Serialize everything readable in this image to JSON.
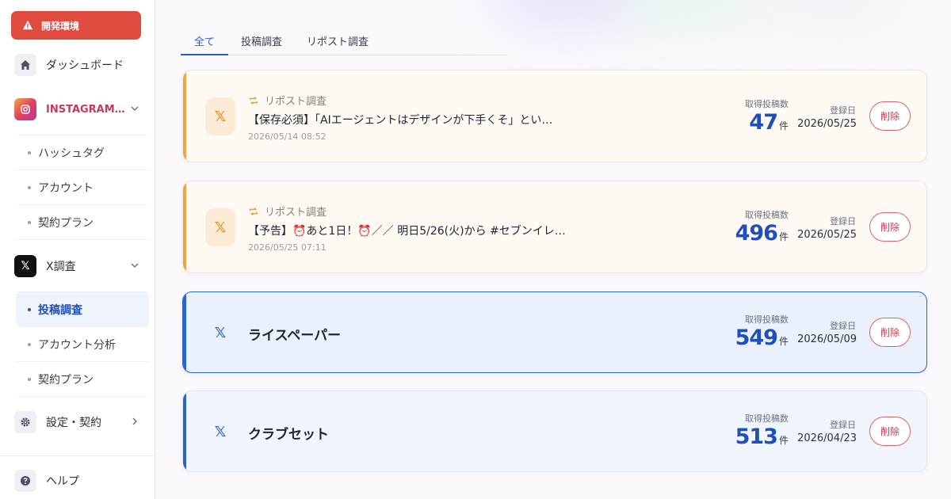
{
  "sidebar": {
    "env_badge": "開発環境",
    "dashboard": "ダッシュボード",
    "instagram": {
      "label": "INSTAGRAM…",
      "items": [
        "ハッシュタグ",
        "アカウント",
        "契約プラン"
      ]
    },
    "x": {
      "label": "X調査",
      "items": [
        "投稿調査",
        "アカウント分析",
        "契約プラン"
      ],
      "active_index": 0
    },
    "settings": "設定・契約",
    "help": "ヘルプ"
  },
  "tabs": {
    "items": [
      "全て",
      "投稿調査",
      "リポスト調査"
    ],
    "active_index": 0
  },
  "cards": [
    {
      "kind": "repost",
      "type_label": "リポスト調査",
      "title": "【保存必須】「AIエージェントはデザインが下手くそ」とい…",
      "timestamp": "2026/05/14 08:52",
      "count_label": "取得投稿数",
      "count": "47",
      "count_unit": "件",
      "reg_label": "登録日",
      "reg_date": "2026/05/25",
      "delete_label": "削除"
    },
    {
      "kind": "repost",
      "type_label": "リポスト調査",
      "title": "【予告】⏰あと1日！⏰／／ 明日5/26(火)から #セブンイレ…",
      "timestamp": "2026/05/25 07:11",
      "count_label": "取得投稿数",
      "count": "496",
      "count_unit": "件",
      "reg_label": "登録日",
      "reg_date": "2026/05/25",
      "delete_label": "削除"
    },
    {
      "kind": "post",
      "title": "ライスペーパー",
      "count_label": "取得投稿数",
      "count": "549",
      "count_unit": "件",
      "reg_label": "登録日",
      "reg_date": "2026/05/09",
      "delete_label": "削除"
    },
    {
      "kind": "post",
      "title": "クラブセット",
      "count_label": "取得投稿数",
      "count": "513",
      "count_unit": "件",
      "reg_label": "登録日",
      "reg_date": "2026/04/23",
      "delete_label": "削除"
    }
  ],
  "colors": {
    "accent_blue": "#1f4fb8",
    "repost_orange": "#f0a545",
    "danger": "#c63d4a",
    "env_red": "#e04a3f"
  },
  "icons": {
    "env_badge": "warning-icon",
    "dashboard": "home-icon",
    "instagram": "instagram-icon",
    "x": "x-logo-icon",
    "settings": "gear-icon",
    "help": "help-icon",
    "repost": "repost-icon"
  }
}
